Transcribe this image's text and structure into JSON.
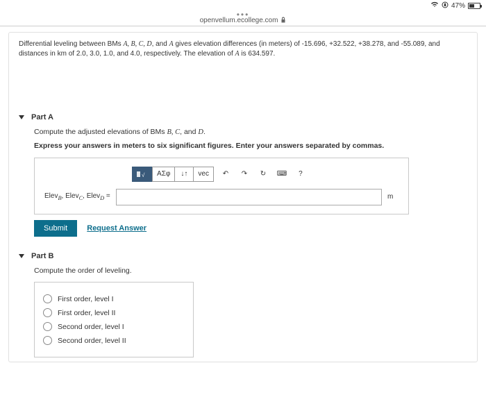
{
  "status": {
    "battery_pct": "47%"
  },
  "url": "openvellum.ecollege.com",
  "problem": {
    "prefix": "Differential leveling between BMs ",
    "bms": "A, B, C, D",
    "mid1": ", and ",
    "bmA1": "A",
    "mid2": " gives elevation differences (in meters) of -15.696, +32.522, +38.278, and -55.089, and distances in ",
    "km": "km",
    "mid3": " of 2.0, 3.0, 1.0, and 4.0, respectively. The elevation of ",
    "bmA2": "A",
    "suffix": " is 634.597."
  },
  "partA": {
    "title": "Part A",
    "line1a": "Compute the adjusted elevations of BMs ",
    "line1b": "B, C",
    "line1c": ", and ",
    "line1d": "D",
    "line1e": ".",
    "line2": "Express your answers in meters to six significant figures. Enter your answers separated by commas.",
    "toolbar": {
      "templates": "",
      "greek": "ΑΣφ",
      "sub": "↓↑",
      "vec": "vec",
      "undo": "↶",
      "redo": "↷",
      "reset": "↻",
      "keyboard": "⌨",
      "help": "?"
    },
    "label": "Elev",
    "subB": "B",
    "subC": "C",
    "subD": "D",
    "equals": " = ",
    "unit": "m",
    "placeholder": ""
  },
  "submit_label": "Submit",
  "request_label": "Request Answer",
  "partB": {
    "title": "Part B",
    "prompt": "Compute the order of leveling.",
    "options": [
      "First order, level I",
      "First order, level II",
      "Second order, level I",
      "Second order, level II"
    ]
  }
}
